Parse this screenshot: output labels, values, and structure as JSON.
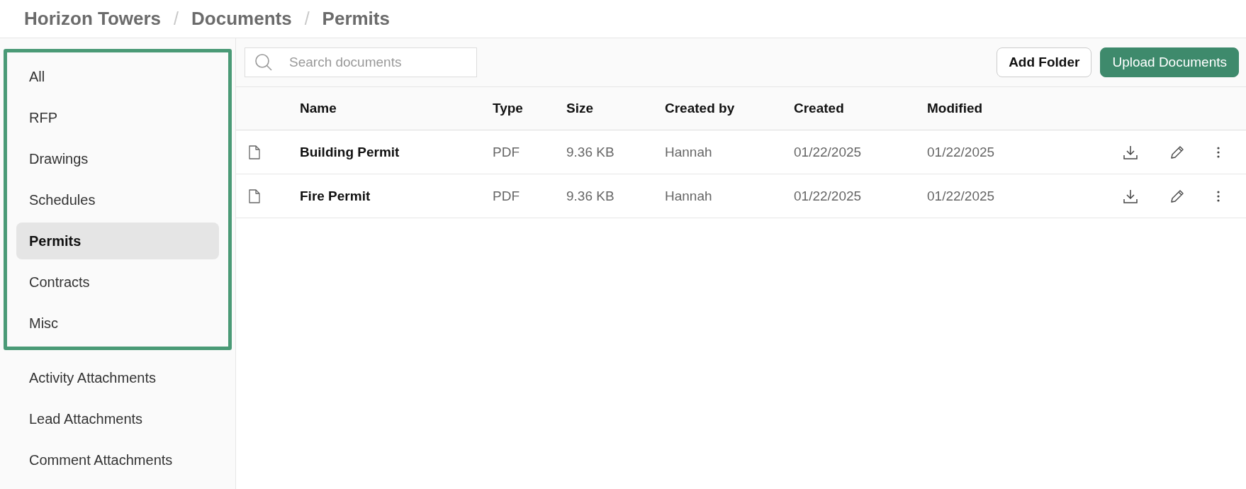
{
  "breadcrumb": [
    "Horizon Towers",
    "Documents",
    "Permits"
  ],
  "breadcrumb_separator": "/",
  "sidebar": {
    "groups": [
      {
        "highlighted": true,
        "items": [
          {
            "label": "All",
            "selected": false
          },
          {
            "label": "RFP",
            "selected": false
          },
          {
            "label": "Drawings",
            "selected": false
          },
          {
            "label": "Schedules",
            "selected": false
          },
          {
            "label": "Permits",
            "selected": true
          },
          {
            "label": "Contracts",
            "selected": false
          },
          {
            "label": "Misc",
            "selected": false
          }
        ]
      },
      {
        "highlighted": false,
        "items": [
          {
            "label": "Activity Attachments",
            "selected": false
          },
          {
            "label": "Lead Attachments",
            "selected": false
          },
          {
            "label": "Comment Attachments",
            "selected": false
          }
        ]
      }
    ]
  },
  "search": {
    "placeholder": "Search documents"
  },
  "buttons": [
    {
      "label": "Add Folder",
      "kind": "secondary"
    },
    {
      "label": "Upload Documents",
      "kind": "primary"
    }
  ],
  "table": {
    "columns": [
      "Name",
      "Type",
      "Size",
      "Created by",
      "Created",
      "Modified"
    ],
    "rows": [
      {
        "cells": [
          "Building Permit",
          "PDF",
          "9.36 KB",
          "Hannah",
          "01/22/2025",
          "01/22/2025"
        ]
      },
      {
        "cells": [
          "Fire Permit",
          "PDF",
          "9.36 KB",
          "Hannah",
          "01/22/2025",
          "01/22/2025"
        ]
      }
    ]
  }
}
